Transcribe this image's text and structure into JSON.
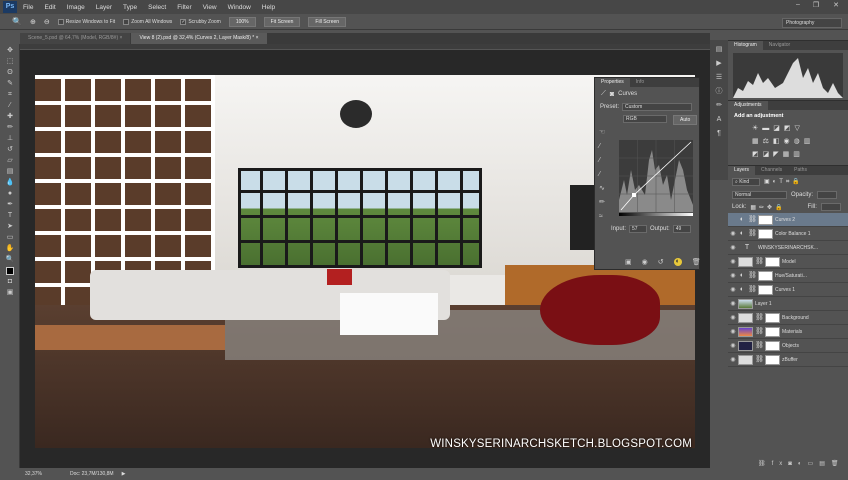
{
  "app": {
    "logo": "Ps",
    "menu": [
      "File",
      "Edit",
      "Image",
      "Layer",
      "Type",
      "Select",
      "Filter",
      "View",
      "Window",
      "Help"
    ]
  },
  "options": {
    "resize_windows": "Resize Windows to Fit",
    "zoom_all": "Zoom All Windows",
    "scrubby_zoom": "Scrubby Zoom",
    "zoom_100": "100%",
    "fit_screen": "Fit Screen",
    "fill_screen": "Fill Screen",
    "workspace": "Photography"
  },
  "tabs": [
    {
      "label": "Scene_5.psd @ 64,7% (Model, RGB/8#)"
    },
    {
      "label": "View 8 (2).psd @ 32,4% (Curves 2, Layer Mask/8) *"
    }
  ],
  "status": {
    "zoom": "32,37%",
    "doc": "Doc: 23,7M/130,8M"
  },
  "watermark": "WINSKYSERINARCHSKETCH.BLOGSPOT.COM",
  "properties": {
    "tabs": [
      "Properties",
      "Info"
    ],
    "title": "Curves",
    "preset_label": "Preset:",
    "preset": "Custom",
    "channel": "RGB",
    "auto": "Auto",
    "input_label": "Input:",
    "input": "57",
    "output_label": "Output:",
    "output": "49"
  },
  "histogram": {
    "tabs": [
      "Histogram",
      "Navigator"
    ]
  },
  "adjustments": {
    "tab": "Adjustments",
    "title": "Add an adjustment"
  },
  "layers": {
    "tabs": [
      "Layers",
      "Channels",
      "Paths"
    ],
    "kind": "Kind",
    "blend": "Normal",
    "opacity_label": "Opacity:",
    "lock_label": "Lock:",
    "fill_label": "Fill:",
    "items": [
      {
        "name": "Curves 2",
        "type": "adj"
      },
      {
        "name": "Color Balance 1",
        "type": "adj"
      },
      {
        "name": "WINSKYSERINARCHSK...",
        "type": "text"
      },
      {
        "name": "Model",
        "type": "img"
      },
      {
        "name": "Hue/Saturati...",
        "type": "adj"
      },
      {
        "name": "Curves 1",
        "type": "adj"
      },
      {
        "name": "Layer 1",
        "type": "photo"
      },
      {
        "name": "Background",
        "type": "img"
      },
      {
        "name": "Materials",
        "type": "img"
      },
      {
        "name": "Objects",
        "type": "img"
      },
      {
        "name": "zBuffer",
        "type": "img"
      }
    ]
  }
}
